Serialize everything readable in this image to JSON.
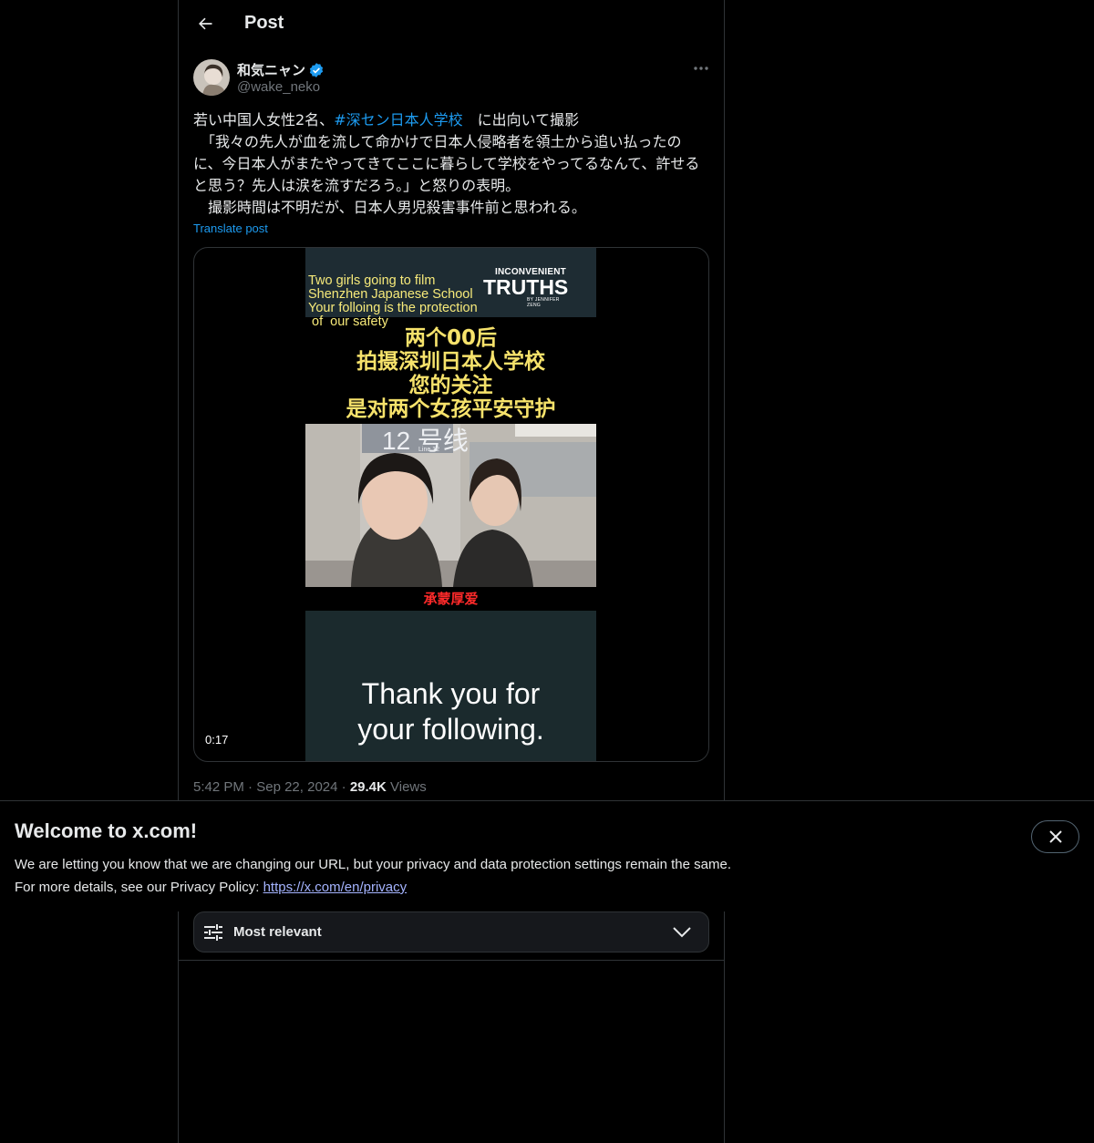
{
  "header": {
    "title": "Post"
  },
  "author": {
    "name": "和気ニャン",
    "handle": "@wake_neko"
  },
  "post": {
    "text_line1_before": "若い中国人女性2名、",
    "hashtag": "#深セン日本人学校",
    "text_line1_after": "　に出向いて撮影\n　「我々の先人が血を流して命かけで日本人侵略者を領土から追い払ったのに、今日本人がまたやってきてここに暮らして学校をやってるなんて、許せると思う？先人は涙を流すだろう。」と怒りの表明。\n　撮影時間は不明だが、日本人男児殺害事件前と思われる。",
    "translate_label": "Translate post"
  },
  "media": {
    "top_text": "Two girls going to film\nShenzhen Japanese School\nYour folloing is the protection\n of  our safety",
    "brand_small": "INCONVENIENT",
    "brand_big": "TRUTHS",
    "brand_mini": "BY JENNIFER ZENG",
    "cn_caption": "两个00后\n拍摄深圳日本人学校\n您的关注\n是对两个女孩平安守护",
    "sign_text": "12 号线",
    "sign_sub": "Line 12",
    "red_caption": "承蒙厚爱",
    "thanks": "Thank you for\nyour following.",
    "duration": "0:17"
  },
  "meta": {
    "time": "5:42 PM",
    "date": "Sep 22, 2024",
    "views_count": "29.4K",
    "views_label": "Views",
    "sep": "·"
  },
  "sort": {
    "label": "Most relevant"
  },
  "banner": {
    "title": "Welcome to x.com!",
    "line1": "We are letting you know that we are changing our URL, but your privacy and data protection settings remain the same.",
    "line2_prefix": "For more details, see our Privacy Policy: ",
    "link": "https://x.com/en/privacy"
  },
  "colors": {
    "accent": "#1d9bf0",
    "background": "#000000",
    "text": "#e7e9ea",
    "muted": "#71767b"
  }
}
